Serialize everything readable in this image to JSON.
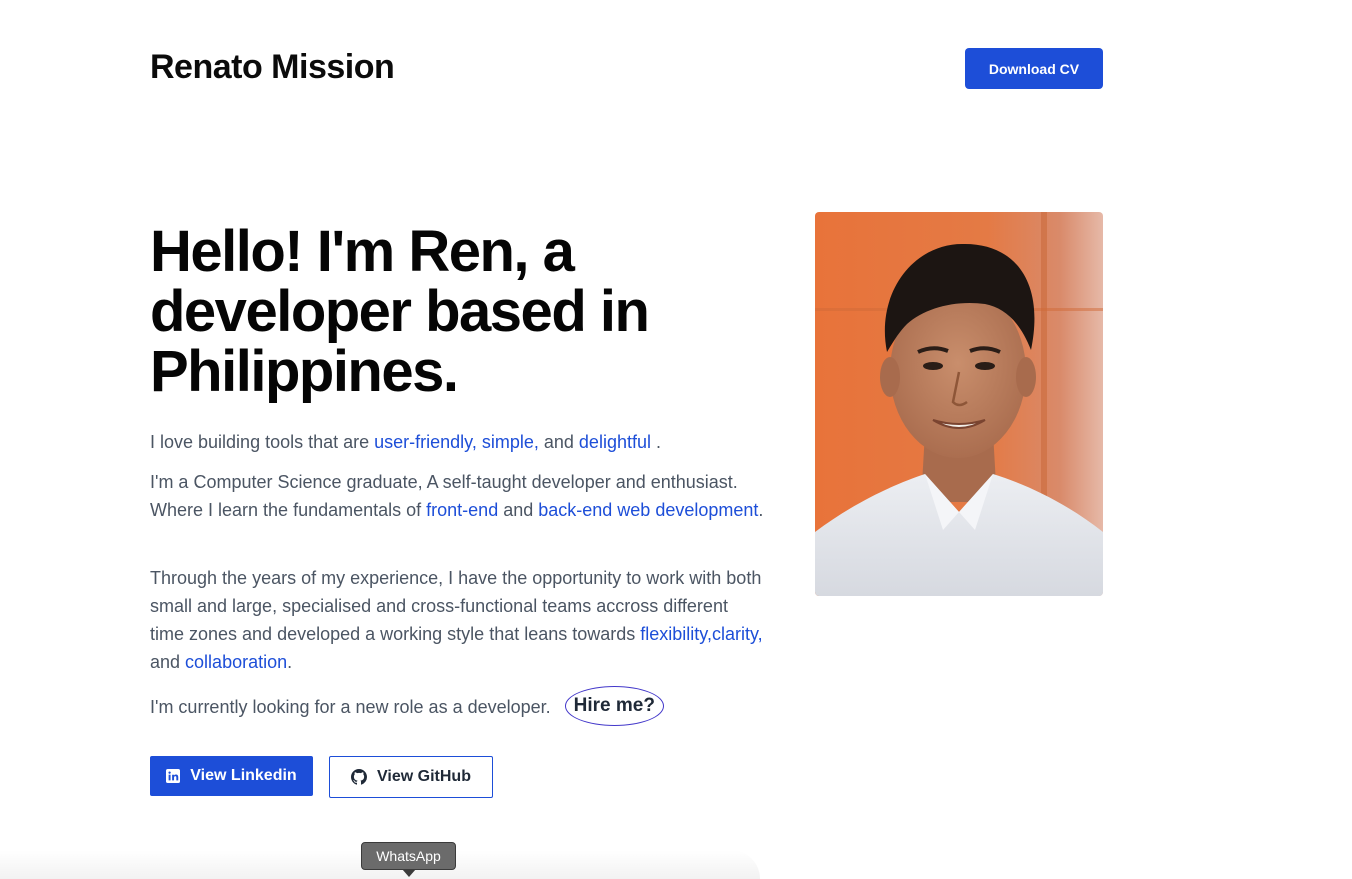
{
  "header": {
    "brand": "Renato Mission",
    "cv_button": "Download CV"
  },
  "hero": {
    "title": "Hello! I'm Ren, a developer based in Philippines.",
    "p1": {
      "before": "I love building tools that are ",
      "link1": "user-friendly,",
      "mid1": " ",
      "link2": "simple,",
      "mid2": " and ",
      "link3": "delightful",
      "after": " ."
    },
    "p2": {
      "before": "I'm a Computer Science graduate, A self-taught developer and enthusiast. Where I learn the fundamentals of ",
      "link1": "front-end",
      "mid": " and ",
      "link2": "back-end web development",
      "after": "."
    },
    "p3": {
      "before": "Through the years of my experience, I have the opportunity to work with both small and large, specialised and cross-functional teams accross different time zones and developed a working style that leans towards ",
      "link1": "flexibility,",
      "link2": "clarity,",
      "mid": " and ",
      "link3": "collaboration",
      "after": "."
    },
    "p4": {
      "text": "I'm currently looking for a new role as a developer.",
      "hire": "Hire me?"
    }
  },
  "buttons": {
    "linkedin": "View Linkedin",
    "github": "View GitHub"
  },
  "tooltip": "WhatsApp",
  "icons": {
    "linkedin": "linkedin-icon",
    "github": "github-icon"
  },
  "colors": {
    "accent": "#1d4ed8",
    "body_text": "#4b5563",
    "portrait_bg": "#e07a3f"
  }
}
